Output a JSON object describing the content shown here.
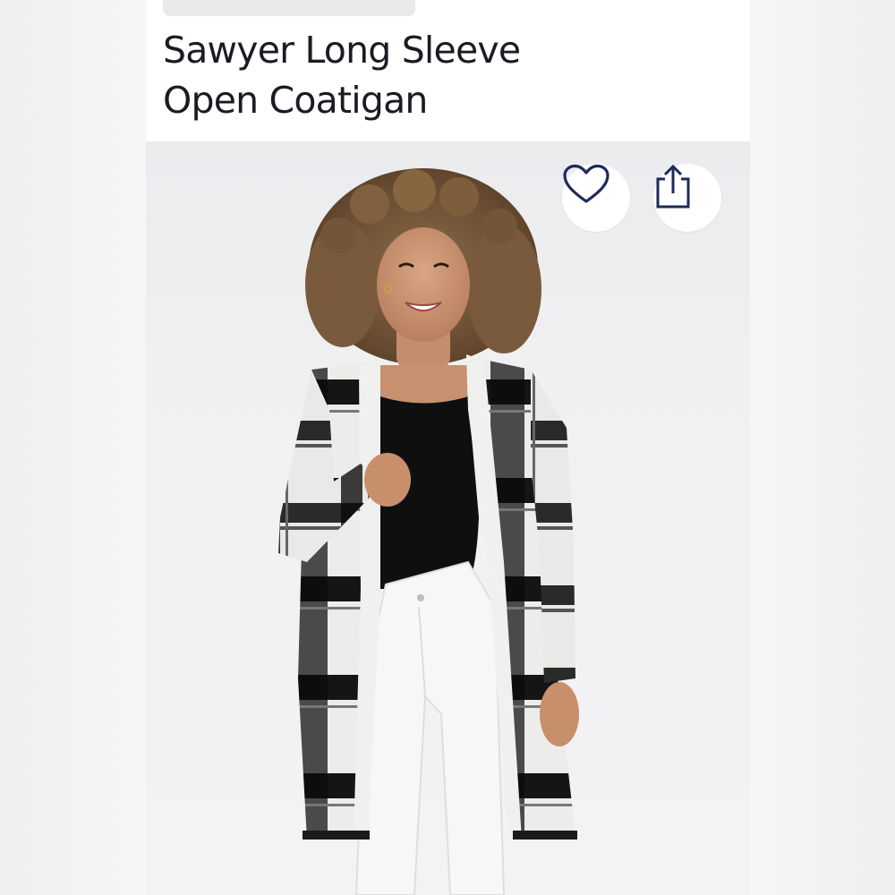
{
  "product": {
    "title_line1": "Sawyer Long Sleeve",
    "title_line2": "Open Coatigan"
  },
  "actions": {
    "like_icon": "heart-icon",
    "share_icon": "share-icon"
  },
  "colors": {
    "icon_navy": "#1c2a5c",
    "title_text": "#1b1b24",
    "photo_bg": "#f1f1f3"
  }
}
